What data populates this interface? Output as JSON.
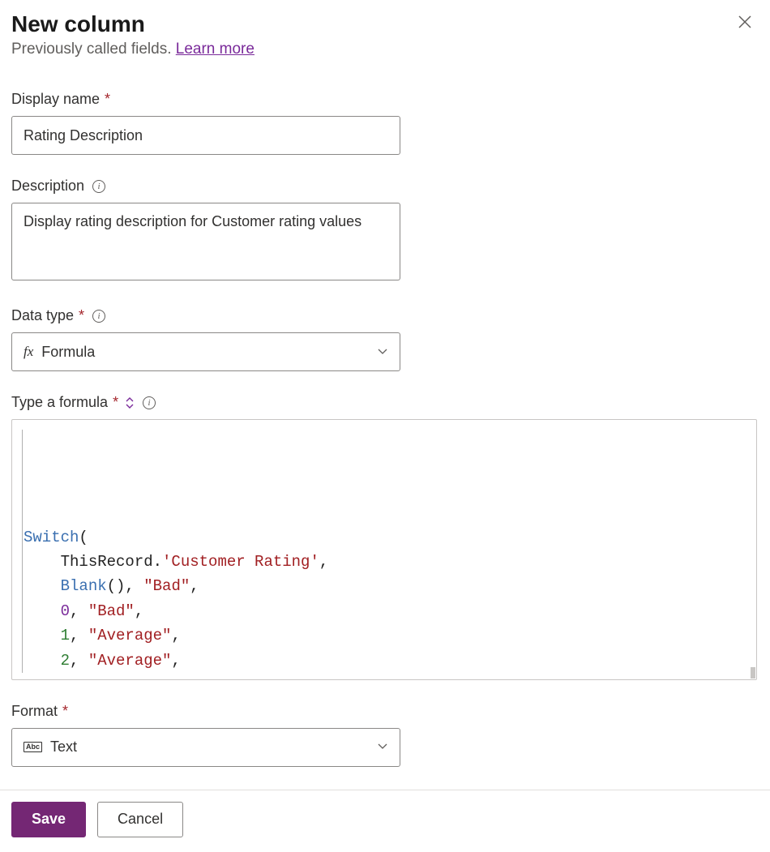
{
  "header": {
    "title": "New column",
    "subtitle_prefix": "Previously called fields. ",
    "learn_more": "Learn more"
  },
  "fields": {
    "display_name": {
      "label": "Display name",
      "value": "Rating Description"
    },
    "description": {
      "label": "Description",
      "value": "Display rating description for Customer rating values"
    },
    "data_type": {
      "label": "Data type",
      "value": "Formula"
    },
    "formula": {
      "label": "Type a formula",
      "lines": [
        {
          "tokens": [
            {
              "t": "fn",
              "v": "Switch"
            },
            {
              "t": "txt",
              "v": "("
            }
          ]
        },
        {
          "tokens": [
            {
              "t": "txt",
              "v": "    ThisRecord."
            },
            {
              "t": "str",
              "v": "'Customer Rating'"
            },
            {
              "t": "txt",
              "v": ","
            }
          ]
        },
        {
          "tokens": [
            {
              "t": "txt",
              "v": "    "
            },
            {
              "t": "fn",
              "v": "Blank"
            },
            {
              "t": "txt",
              "v": "(), "
            },
            {
              "t": "str",
              "v": "\"Bad\""
            },
            {
              "t": "txt",
              "v": ","
            }
          ]
        },
        {
          "tokens": [
            {
              "t": "txt",
              "v": "    "
            },
            {
              "t": "zero",
              "v": "0"
            },
            {
              "t": "txt",
              "v": ", "
            },
            {
              "t": "str",
              "v": "\"Bad\""
            },
            {
              "t": "txt",
              "v": ","
            }
          ]
        },
        {
          "tokens": [
            {
              "t": "txt",
              "v": "    "
            },
            {
              "t": "num",
              "v": "1"
            },
            {
              "t": "txt",
              "v": ", "
            },
            {
              "t": "str",
              "v": "\"Average\""
            },
            {
              "t": "txt",
              "v": ","
            }
          ]
        },
        {
          "tokens": [
            {
              "t": "txt",
              "v": "    "
            },
            {
              "t": "num",
              "v": "2"
            },
            {
              "t": "txt",
              "v": ", "
            },
            {
              "t": "str",
              "v": "\"Average\""
            },
            {
              "t": "txt",
              "v": ","
            }
          ]
        }
      ]
    },
    "format": {
      "label": "Format",
      "value": "Text"
    }
  },
  "footer": {
    "save": "Save",
    "cancel": "Cancel"
  }
}
